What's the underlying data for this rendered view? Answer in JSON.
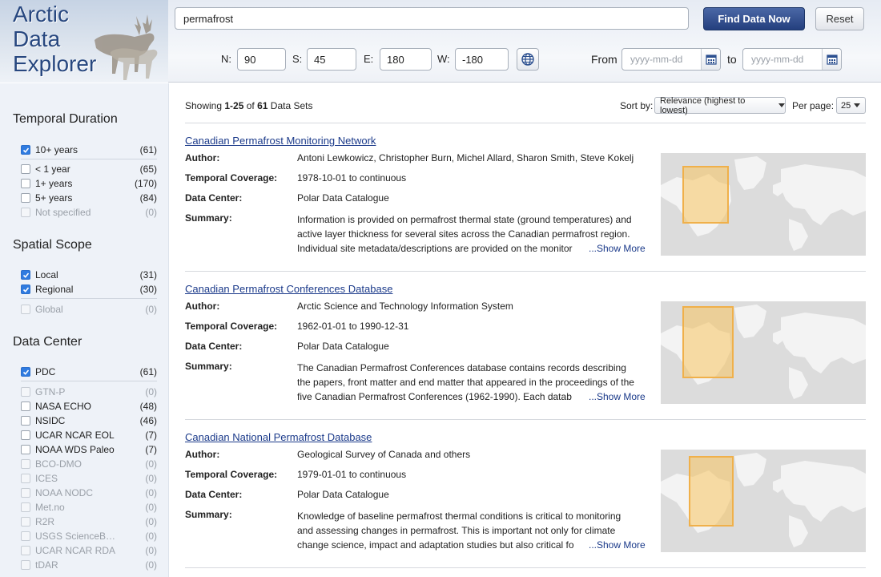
{
  "app": {
    "logo_lines": [
      "Arctic",
      "Data",
      "Explorer"
    ]
  },
  "search": {
    "value": "permafrost",
    "find_label": "Find Data Now",
    "reset_label": "Reset"
  },
  "coords": {
    "n_label": "N:",
    "n_value": "90",
    "s_label": "S:",
    "s_value": "45",
    "e_label": "E:",
    "e_value": "180",
    "w_label": "W:",
    "w_value": "-180"
  },
  "dates": {
    "from_label": "From",
    "to_label": "to",
    "from_placeholder": "yyyy-mm-dd",
    "to_placeholder": "yyyy-mm-dd"
  },
  "facets": {
    "temporal": {
      "title": "Temporal Duration",
      "items": [
        {
          "label": "10+ years",
          "count": "(61)",
          "checked": true,
          "disabled": false
        },
        {
          "label": "< 1 year",
          "count": "(65)",
          "checked": false,
          "disabled": false
        },
        {
          "label": "1+ years",
          "count": "(170)",
          "checked": false,
          "disabled": false
        },
        {
          "label": "5+ years",
          "count": "(84)",
          "checked": false,
          "disabled": false
        },
        {
          "label": "Not specified",
          "count": "(0)",
          "checked": false,
          "disabled": true
        }
      ]
    },
    "spatial": {
      "title": "Spatial Scope",
      "items": [
        {
          "label": "Local",
          "count": "(31)",
          "checked": true,
          "disabled": false
        },
        {
          "label": "Regional",
          "count": "(30)",
          "checked": true,
          "disabled": false
        },
        {
          "label": "Global",
          "count": "(0)",
          "checked": false,
          "disabled": true
        }
      ]
    },
    "datacenter": {
      "title": "Data Center",
      "items": [
        {
          "label": "PDC",
          "count": "(61)",
          "checked": true,
          "disabled": false
        },
        {
          "label": "GTN-P",
          "count": "(0)",
          "checked": false,
          "disabled": true
        },
        {
          "label": "NASA ECHO",
          "count": "(48)",
          "checked": false,
          "disabled": false
        },
        {
          "label": "NSIDC",
          "count": "(46)",
          "checked": false,
          "disabled": false
        },
        {
          "label": "UCAR NCAR EOL",
          "count": "(7)",
          "checked": false,
          "disabled": false
        },
        {
          "label": "NOAA WDS Paleo",
          "count": "(7)",
          "checked": false,
          "disabled": false
        },
        {
          "label": "BCO-DMO",
          "count": "(0)",
          "checked": false,
          "disabled": true
        },
        {
          "label": "ICES",
          "count": "(0)",
          "checked": false,
          "disabled": true
        },
        {
          "label": "NOAA NODC",
          "count": "(0)",
          "checked": false,
          "disabled": true
        },
        {
          "label": "Met.no",
          "count": "(0)",
          "checked": false,
          "disabled": true
        },
        {
          "label": "R2R",
          "count": "(0)",
          "checked": false,
          "disabled": true
        },
        {
          "label": "USGS ScienceB…",
          "count": "(0)",
          "checked": false,
          "disabled": true
        },
        {
          "label": "UCAR NCAR RDA",
          "count": "(0)",
          "checked": false,
          "disabled": true
        },
        {
          "label": "tDAR",
          "count": "(0)",
          "checked": false,
          "disabled": true
        }
      ]
    }
  },
  "results_header": {
    "showing_prefix": "Showing ",
    "range": "1-25",
    "of_text": " of ",
    "total": "61",
    "suffix": " Data Sets",
    "sort_label": "Sort by:",
    "sort_value": "Relevance (highest to lowest)",
    "perpage_label": "Per page:",
    "perpage_value": "25"
  },
  "labels": {
    "author": "Author:",
    "temporal": "Temporal Coverage:",
    "datacenter": "Data Center:",
    "summary": "Summary:",
    "show_more": "...Show More"
  },
  "results": [
    {
      "title": "Canadian Permafrost Monitoring Network",
      "author": "Antoni Lewkowicz, Christopher Burn, Michel Allard, Sharon Smith, Steve Kokelj",
      "temporal": "1978-10-01 to continuous",
      "datacenter": "Polar Data Catalogue",
      "summary": "Information is provided on permafrost thermal state (ground temperatures) and active layer thickness for several sites across the Canadian permafrost region. Individual site metadata/descriptions are provided on the monitor"
    },
    {
      "title": "Canadian Permafrost Conferences Database",
      "author": "Arctic Science and Technology Information System",
      "temporal": "1962-01-01 to 1990-12-31",
      "datacenter": "Polar Data Catalogue",
      "summary": "The Canadian Permafrost Conferences database contains records describing the papers, front matter and end matter that appeared in the proceedings of the five Canadian Permafrost Conferences (1962-1990). Each datab"
    },
    {
      "title": "Canadian National Permafrost Database",
      "author": "Geological Survey of Canada and others",
      "temporal": "1979-01-01 to continuous",
      "datacenter": "Polar Data Catalogue",
      "summary": "Knowledge of baseline permafrost thermal conditions is critical to monitoring and assessing changes in permafrost. This is important not only for climate change science, impact and adaptation studies but also critical fo"
    }
  ]
}
